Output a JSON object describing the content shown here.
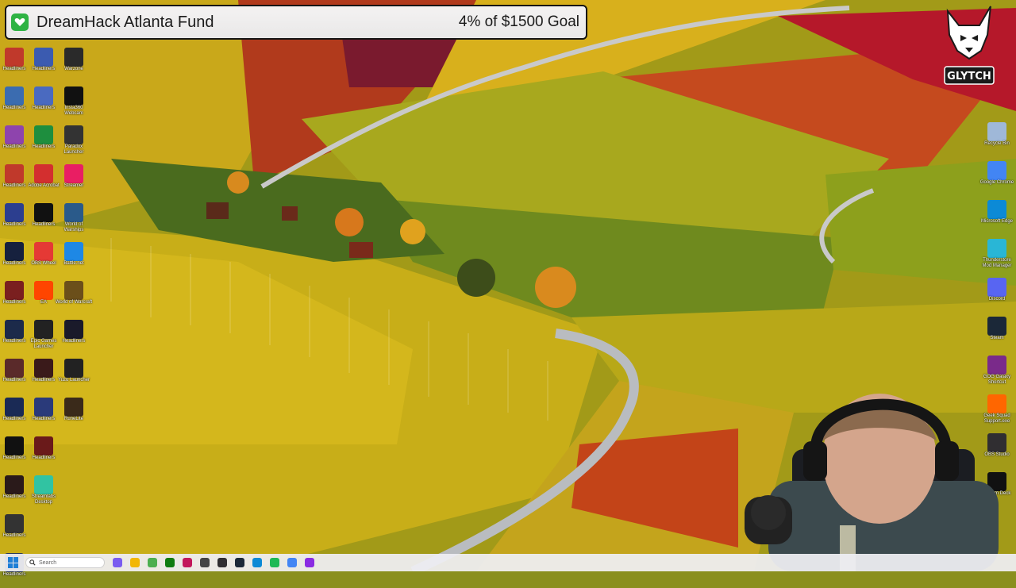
{
  "overlay": {
    "title": "DreamHack Atlanta Fund",
    "progress_text": "4% of $1500 Goal",
    "progress_fraction": 0.04
  },
  "colors": {
    "goal_icon": "#2fb344",
    "taskbar": "#eeeef2",
    "field_yellow": "#c9b21a",
    "field_red": "#b3331c"
  },
  "desktop_left": [
    {
      "label": "Headliners",
      "color": "#c0392b"
    },
    {
      "label": "Headliners",
      "color": "#3b6cb0"
    },
    {
      "label": "Headliners",
      "color": "#8e44ad"
    },
    {
      "label": "Headliners",
      "color": "#c0392b"
    },
    {
      "label": "Headliners",
      "color": "#2c3e8f"
    },
    {
      "label": "Headliners",
      "color": "#16213e"
    },
    {
      "label": "Headliners",
      "color": "#7a1f1f"
    },
    {
      "label": "Headliners",
      "color": "#1c2a4a"
    },
    {
      "label": "Headliners",
      "color": "#5a2a2a"
    },
    {
      "label": "Headliners",
      "color": "#1a2a55"
    },
    {
      "label": "Headliners",
      "color": "#111111"
    },
    {
      "label": "Headliners",
      "color": "#2a1a1a"
    },
    {
      "label": "Headliners",
      "color": "#333333"
    },
    {
      "label": "Headliners",
      "color": "#2a3a5a"
    }
  ],
  "desktop_mid": [
    {
      "label": "Headliners",
      "color": "#3b5bb0"
    },
    {
      "label": "Headliners",
      "color": "#4a6ac0"
    },
    {
      "label": "Headliners",
      "color": "#1e8e3e"
    },
    {
      "label": "Adobe Acrobat",
      "color": "#d32f2f"
    },
    {
      "label": "Headliners",
      "color": "#111111"
    },
    {
      "label": "OBS Wheel",
      "color": "#e53935"
    },
    {
      "label": "EA",
      "color": "#ff4500"
    },
    {
      "label": "Epic Games Launcher",
      "color": "#222222"
    },
    {
      "label": "Headliners",
      "color": "#3a1a1a"
    },
    {
      "label": "Headliners",
      "color": "#2a3a7a"
    },
    {
      "label": "Headliners",
      "color": "#6a1a1a"
    },
    {
      "label": "Streamlabs Desktop",
      "color": "#31c3a2"
    }
  ],
  "desktop_third": [
    {
      "label": "Warzone",
      "color": "#2a2a2a"
    },
    {
      "label": "Insta360 Webcam",
      "color": "#111111"
    },
    {
      "label": "Paradox Launcher",
      "color": "#333333"
    },
    {
      "label": "Streamer",
      "color": "#e91e63"
    },
    {
      "label": "World of Warships",
      "color": "#2a5a8a"
    },
    {
      "label": "Battle.net",
      "color": "#1e88e5"
    },
    {
      "label": "World of Warcraft",
      "color": "#6b4f1a"
    },
    {
      "label": "Headliners",
      "color": "#1a1a2a"
    },
    {
      "label": "Yuzu Launcher",
      "color": "#222222"
    },
    {
      "label": "RuneLite",
      "color": "#3a2a1a"
    }
  ],
  "desktop_right": [
    {
      "label": "Recycle Bin",
      "color": "#9fb8d8"
    },
    {
      "label": "Google Chrome",
      "color": "#4285f4"
    },
    {
      "label": "Microsoft Edge",
      "color": "#0c8ad6"
    },
    {
      "label": "Thunderstore Mod Manager",
      "color": "#29b6d6"
    },
    {
      "label": "Discord",
      "color": "#5865f2"
    },
    {
      "label": "Steam",
      "color": "#1b2838"
    },
    {
      "label": "GOG Galaxy Shortcut",
      "color": "#7a2a8a"
    },
    {
      "label": "Geek Squad Support.exe",
      "color": "#ff6600"
    },
    {
      "label": "OBS Studio",
      "color": "#302e31"
    },
    {
      "label": "Stream Deck",
      "color": "#111111"
    }
  ],
  "taskbar": {
    "search_placeholder": "Search",
    "apps": [
      {
        "name": "copilot-icon",
        "color": "#7a5cf0"
      },
      {
        "name": "file-explorer-icon",
        "color": "#f2b705"
      },
      {
        "name": "minecraft-icon",
        "color": "#4caf50"
      },
      {
        "name": "xbox-icon",
        "color": "#107c10"
      },
      {
        "name": "store-icon",
        "color": "#c2185b"
      },
      {
        "name": "app-icon",
        "color": "#444444"
      },
      {
        "name": "obs-icon",
        "color": "#302e31"
      },
      {
        "name": "steam-icon",
        "color": "#1b2838"
      },
      {
        "name": "edge-icon",
        "color": "#0c8ad6"
      },
      {
        "name": "spotify-icon",
        "color": "#1db954"
      },
      {
        "name": "chrome-icon",
        "color": "#4285f4"
      },
      {
        "name": "streamlabs-icon",
        "color": "#8a2be2"
      }
    ]
  },
  "brand": {
    "logo_text": "GLYTCH"
  }
}
